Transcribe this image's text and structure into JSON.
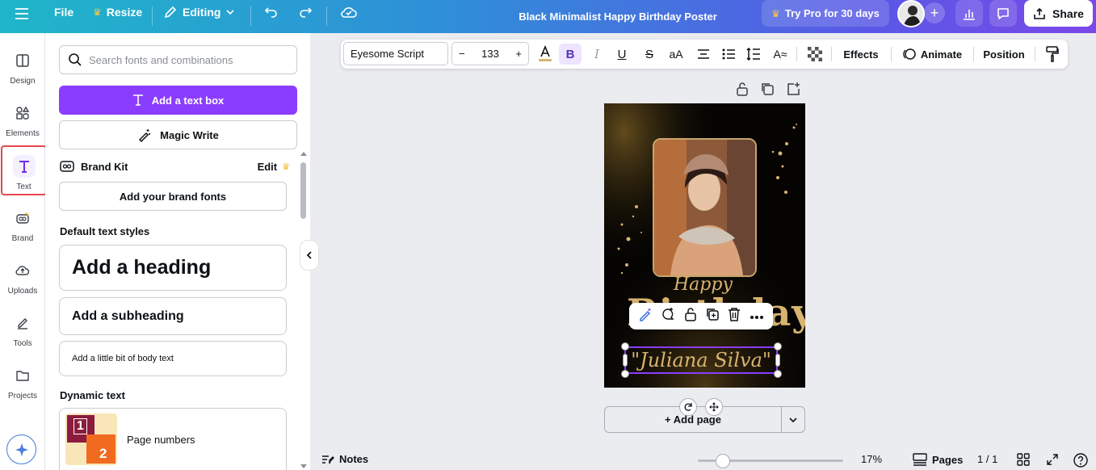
{
  "topbar": {
    "menu_icon": "hamburger-icon",
    "file": "File",
    "resize": "Resize",
    "editing": "Editing",
    "title": "Black Minimalist Happy Birthday Poster",
    "try_pro": "Try Pro for 30 days",
    "share": "Share"
  },
  "rail": {
    "items": [
      {
        "label": "Design",
        "icon": "design-icon"
      },
      {
        "label": "Elements",
        "icon": "elements-icon"
      },
      {
        "label": "Text",
        "icon": "text-icon"
      },
      {
        "label": "Brand",
        "icon": "brand-icon"
      },
      {
        "label": "Uploads",
        "icon": "uploads-icon"
      },
      {
        "label": "Tools",
        "icon": "tools-icon"
      },
      {
        "label": "Projects",
        "icon": "projects-icon"
      }
    ]
  },
  "panel": {
    "search_placeholder": "Search fonts and combinations",
    "add_text_box": "Add a text box",
    "magic_write": "Magic Write",
    "brand_kit": "Brand Kit",
    "brand_edit": "Edit",
    "add_brand_fonts": "Add your brand fonts",
    "default_styles_title": "Default text styles",
    "heading": "Add a heading",
    "subheading": "Add a subheading",
    "body": "Add a little bit of body text",
    "dynamic_title": "Dynamic text",
    "page_numbers": "Page numbers",
    "page_numbers_thumb": [
      "1",
      "2"
    ]
  },
  "format_toolbar": {
    "font": "Eyesome Script",
    "size_minus": "−",
    "size": "133",
    "size_plus": "+",
    "effects": "Effects",
    "animate": "Animate",
    "position": "Position"
  },
  "poster": {
    "happy": "Happy",
    "birthday": "Birthday",
    "name": "\"Juliana Silva\""
  },
  "canvas": {
    "add_page": "+ Add page"
  },
  "bottombar": {
    "notes": "Notes",
    "zoom": "17%",
    "zoom_level": 0.17,
    "pages": "Pages",
    "page_count": "1 / 1"
  },
  "colors": {
    "accent": "#8b3dff",
    "gold": "#d8b46f",
    "highlight_border": "#e5484d"
  }
}
